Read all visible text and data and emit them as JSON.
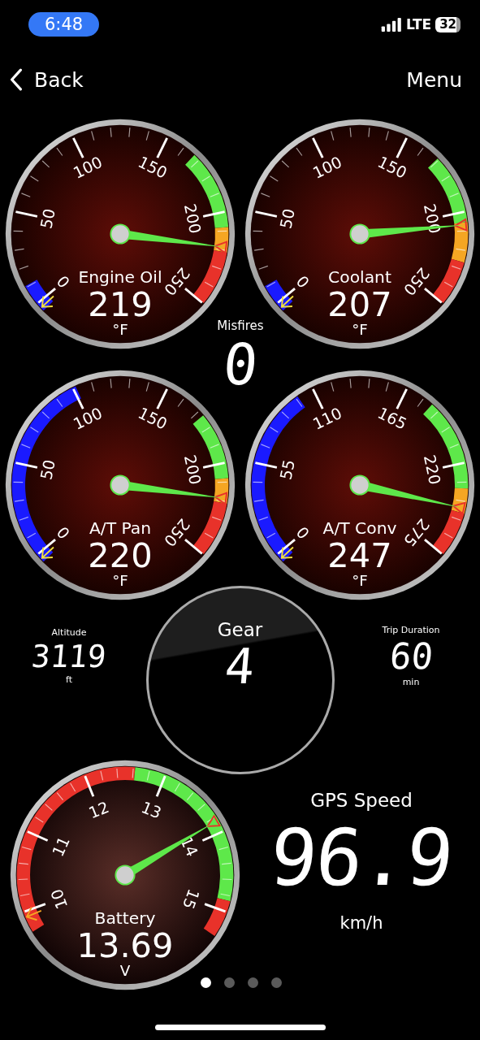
{
  "status_bar": {
    "time": "6:48",
    "network": "LTE",
    "battery": "32"
  },
  "nav": {
    "back": "Back",
    "menu": "Menu"
  },
  "gauges": [
    {
      "kind": "temperature",
      "title": "Engine Oil",
      "value": "219",
      "unit": "°F",
      "labels": [
        "0",
        "50",
        "100",
        "150",
        "200",
        "250"
      ]
    },
    {
      "kind": "temperature",
      "title": "Coolant",
      "value": "207",
      "unit": "°F",
      "labels": [
        "0",
        "50",
        "100",
        "150",
        "200",
        "250"
      ]
    },
    {
      "kind": "temperature",
      "title": "A/T Pan",
      "value": "220",
      "unit": "°F",
      "labels": [
        "0",
        "50",
        "100",
        "150",
        "200",
        "250"
      ]
    },
    {
      "kind": "temperature",
      "title": "A/T Conv",
      "value": "247",
      "unit": "°F",
      "labels": [
        "0",
        "55",
        "110",
        "165",
        "220",
        "275"
      ]
    }
  ],
  "misfires": {
    "label": "Misfires",
    "value": "0"
  },
  "altitude": {
    "label": "Altitude",
    "value": "3119",
    "unit": "ft"
  },
  "gear": {
    "label": "Gear",
    "value": "4"
  },
  "trip_duration": {
    "label": "Trip Duration",
    "value": "60",
    "unit": "min"
  },
  "battery_gauge": {
    "kind": "voltage",
    "title": "Battery",
    "value": "13.69",
    "unit": "V",
    "labels": [
      "10",
      "11",
      "12",
      "13",
      "14",
      "15"
    ]
  },
  "gps_speed": {
    "label": "GPS Speed",
    "value": "96.9",
    "unit": "km/h"
  },
  "page_dots": [
    {
      "selected": true
    },
    {
      "selected": false
    },
    {
      "selected": false
    },
    {
      "selected": false
    }
  ]
}
